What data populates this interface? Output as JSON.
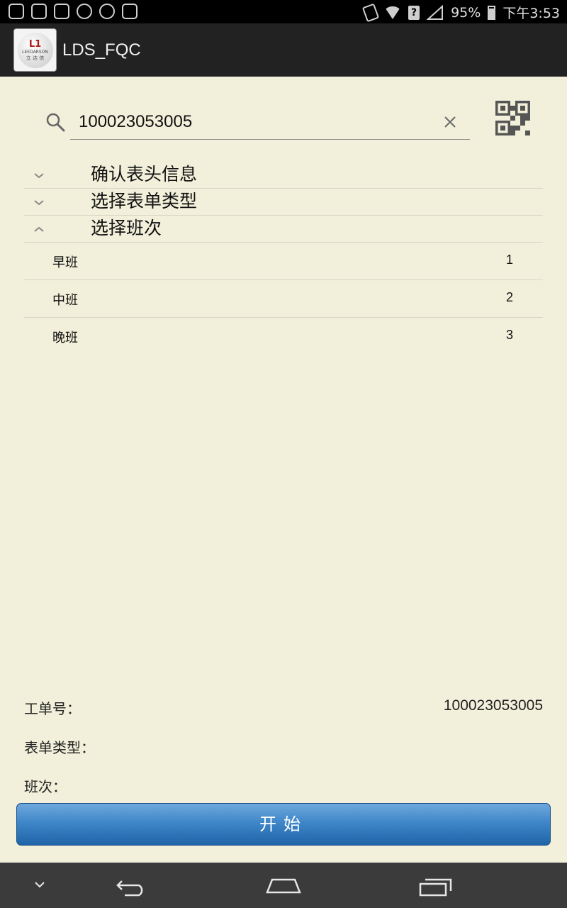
{
  "status_bar": {
    "battery": "95%",
    "time": "下午3:53"
  },
  "app": {
    "title": "LDS_FQC",
    "logo": {
      "mark": "L1",
      "brand": "LEEDARSON",
      "brand_cn": "立 达 信"
    }
  },
  "search": {
    "value": "100023053005",
    "placeholder": ""
  },
  "groups": [
    {
      "label": "确认表头信息",
      "expanded": false
    },
    {
      "label": "选择表单类型",
      "expanded": false
    },
    {
      "label": "选择班次",
      "expanded": true
    }
  ],
  "shifts": [
    {
      "name": "早班",
      "value": "1"
    },
    {
      "name": "中班",
      "value": "2"
    },
    {
      "name": "晚班",
      "value": "3"
    }
  ],
  "summary": {
    "order_label": "工单号：",
    "order_value": "100023053005",
    "form_type_label": "表单类型：",
    "form_type_value": "",
    "shift_label": "班次：",
    "shift_value": ""
  },
  "start_button": "开始",
  "colors": {
    "background": "#f2f0da",
    "action_bar": "#222222",
    "button": "#2f79bd",
    "navbar": "#3b3b3b"
  },
  "icons": [
    "search-icon",
    "clear-icon",
    "qr-code-icon",
    "chevron-down-icon",
    "chevron-up-icon",
    "back-icon",
    "home-icon",
    "recents-icon"
  ]
}
